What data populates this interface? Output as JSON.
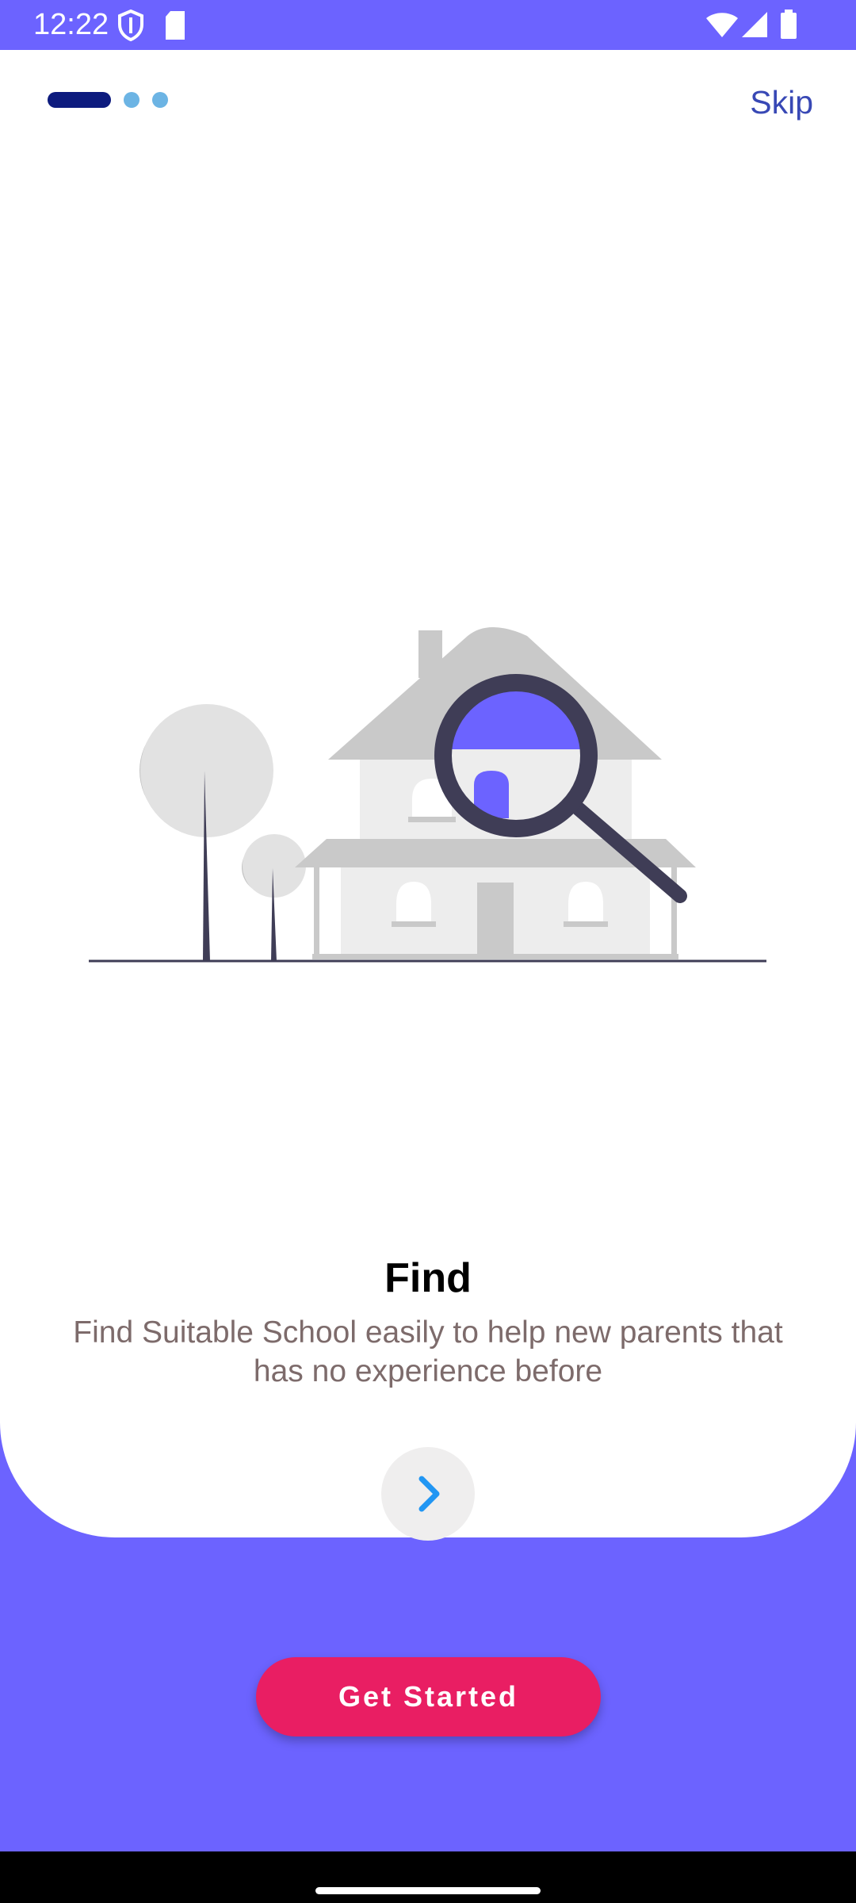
{
  "status_bar": {
    "time": "12:22",
    "left_icons": [
      "shield-icon",
      "sd-card-icon"
    ],
    "right_icons": [
      "wifi-icon",
      "cellular-signal-icon",
      "battery-icon"
    ]
  },
  "onboarding": {
    "pager": {
      "total_pages": 3,
      "current_page": 1
    },
    "skip_label": "Skip",
    "title": "Find",
    "description": "Find Suitable School easily to help new parents that has no experience before",
    "next_icon": "chevron-right-icon",
    "illustration": "house-search-illustration"
  },
  "get_started_label": "Get Started",
  "colors": {
    "background": "#6c63ff",
    "card": "#ffffff",
    "accent_button": "#e91e63",
    "pager_active": "#0d1b7e",
    "pager_inactive": "#6cb4e4",
    "skip_text": "#3848b5",
    "next_arrow": "#2196f3"
  }
}
